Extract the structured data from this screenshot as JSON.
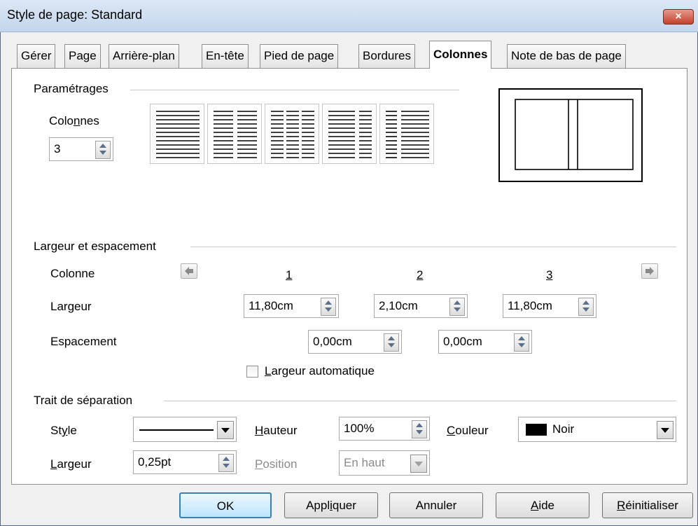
{
  "window": {
    "title": "Style de page: Standard",
    "close_label": "×"
  },
  "tabs": [
    {
      "label": "Gérer",
      "active": false
    },
    {
      "label": "Page",
      "active": false
    },
    {
      "label": "Arrière-plan",
      "active": false
    },
    {
      "label": "En-tête",
      "active": false
    },
    {
      "label": "Pied de page",
      "active": false
    },
    {
      "label": "Bordures",
      "active": false
    },
    {
      "label": "Colonnes",
      "active": true
    },
    {
      "label": "Note de bas de page",
      "active": false
    }
  ],
  "parametrages": {
    "group_label": "Paramétrages",
    "columns_label_pre": "Colo",
    "columns_label_u": "n",
    "columns_label_post": "nes",
    "columns_value": "3",
    "presets": [
      {
        "name": "1 colonne",
        "columns": 1
      },
      {
        "name": "2 colonnes",
        "columns": 2
      },
      {
        "name": "3 colonnes",
        "columns": 3
      },
      {
        "name": "2 colonnes gauche large",
        "columns": 2
      },
      {
        "name": "2 colonnes droite large",
        "columns": 2
      }
    ]
  },
  "largeur_espacement": {
    "group_label": "Largeur et espacement",
    "colonne_label": "Colonne",
    "largeur_label": "Largeur",
    "espacement_label": "Espacement",
    "column_numbers": [
      "1",
      "2",
      "3"
    ],
    "widths": [
      "11,80cm",
      "2,10cm",
      "11,80cm"
    ],
    "spacings": [
      "0,00cm",
      "0,00cm"
    ],
    "auto_width_u": "L",
    "auto_width_rest": "argeur automatique",
    "auto_width_checked": false
  },
  "separateur": {
    "group_label": "Trait de séparation",
    "style_label_pre": "St",
    "style_label_u": "y",
    "style_label_post": "le",
    "hauteur_u": "H",
    "hauteur_rest": "auteur",
    "hauteur_value": "100%",
    "couleur_u": "C",
    "couleur_rest": "ouleur",
    "couleur_value": "Noir",
    "couleur_swatch": "#000000",
    "largeur_u": "L",
    "largeur_rest": "argeur",
    "largeur_value": "0,25pt",
    "position_u": "P",
    "position_rest": "osition",
    "position_value": "En haut"
  },
  "buttons": {
    "ok": "OK",
    "appliquer_pre": "Appl",
    "appliquer_u": "i",
    "appliquer_post": "quer",
    "annuler": "Annuler",
    "aide_u": "A",
    "aide_rest": "ide",
    "reinit_u": "R",
    "reinit_rest": "éinitialiser"
  },
  "colors": {
    "title_bar": "#c4d6ec",
    "default_button_border": "#3c7fb1",
    "close_button": "#c4402c"
  }
}
